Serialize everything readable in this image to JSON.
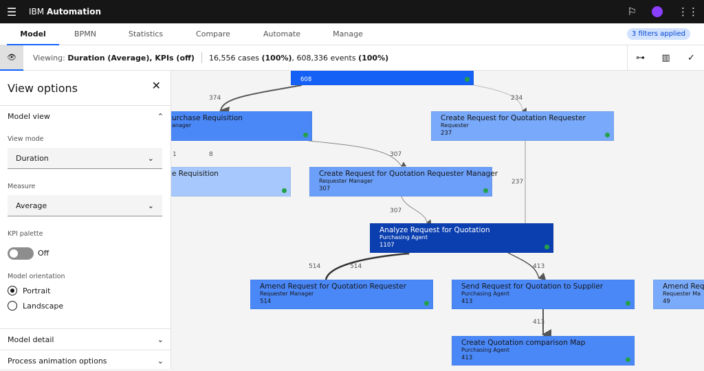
{
  "header": {
    "menu_icon": "hamburger-icon",
    "brand_prefix": "IBM",
    "brand_name": "Automation"
  },
  "tabs": [
    "Model",
    "BPMN",
    "Statistics",
    "Compare",
    "Automate",
    "Manage"
  ],
  "filters_badge": "3 filters applied",
  "viewbar": {
    "viewing_label": "Viewing:",
    "viewing_value": "Duration (Average), KPIs (off)",
    "cases": "16,556 cases",
    "cases_pct": "(100%)",
    "events": ", 608,336 events",
    "events_pct": "(100%)"
  },
  "sidebar": {
    "title": "View options",
    "model_view": "Model view",
    "view_mode_label": "View mode",
    "view_mode": "Duration",
    "measure_label": "Measure",
    "measure": "Average",
    "kpi_label": "KPI palette",
    "kpi_state": "Off",
    "orientation_label": "Model orientation",
    "portrait": "Portrait",
    "landscape": "Landscape",
    "model_detail": "Model detail",
    "animation": "Process animation options"
  },
  "nodes": [
    {
      "title": "",
      "role": "",
      "count": "608",
      "color": "#1560f5"
    },
    {
      "title": "urchase Requisition",
      "role": "anager",
      "count": "",
      "color": "#4a88f8"
    },
    {
      "title": "Create Request for Quotation Requester",
      "role": "Requester",
      "count": "237",
      "color": "#78a9fa"
    },
    {
      "title": "e Requisition",
      "role": "",
      "count": "",
      "color": "#a6c8fc"
    },
    {
      "title": "Create Request for Quotation Requester Manager",
      "role": "Requester Manager",
      "count": "307",
      "color": "#6b9ff9"
    },
    {
      "title": "Analyze Request for Quotation",
      "role": "Purchasing Agent",
      "count": "1107",
      "color": "#0b3fb0"
    },
    {
      "title": "Amend Request for Quotation Requester",
      "role": "Requester Manager",
      "count": "514",
      "color": "#4a88f8"
    },
    {
      "title": "Send Request for Quotation to Supplier",
      "role": "Purchasing Agent",
      "count": "413",
      "color": "#4a88f8"
    },
    {
      "title": "Amend Requ",
      "role": "Requester Ma",
      "count": "49",
      "color": "#7aaafa"
    },
    {
      "title": "Create Quotation comparison Map",
      "role": "Purchasing Agent",
      "count": "413",
      "color": "#4a88f8"
    }
  ],
  "edge_labels": [
    "374",
    "234",
    "1",
    "8",
    "307",
    "237",
    "307",
    "514",
    "514",
    "413",
    "413"
  ]
}
